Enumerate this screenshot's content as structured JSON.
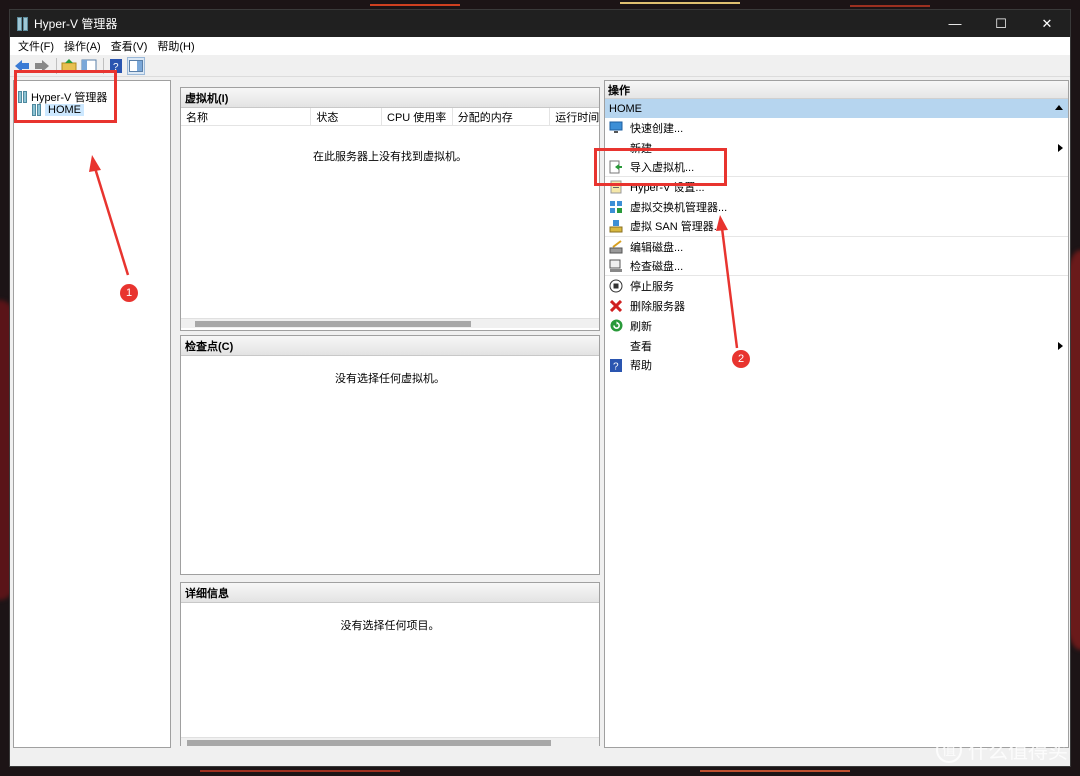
{
  "window": {
    "title": "Hyper-V 管理器"
  },
  "menus": [
    "文件(F)",
    "操作(A)",
    "查看(V)",
    "帮助(H)"
  ],
  "tree": {
    "root": "Hyper-V 管理器",
    "child": "HOME"
  },
  "vm_panel": {
    "header": "虚拟机(I)",
    "columns": [
      "名称",
      "状态",
      "CPU 使用率",
      "分配的内存",
      "运行时间"
    ],
    "empty": "在此服务器上没有找到虚拟机。"
  },
  "checkpoint_panel": {
    "header": "检查点(C)",
    "empty": "没有选择任何虚拟机。"
  },
  "details_panel": {
    "header": "详细信息",
    "empty": "没有选择任何项目。"
  },
  "actions": {
    "header": "操作",
    "group": "HOME",
    "items": [
      "快速创建...",
      "新建",
      "导入虚拟机...",
      "Hyper-V 设置...",
      "虚拟交换机管理器...",
      "虚拟 SAN 管理器...",
      "编辑磁盘...",
      "检查磁盘...",
      "停止服务",
      "删除服务器",
      "刷新",
      "查看",
      "帮助"
    ]
  },
  "annotations": {
    "badge1": "1",
    "badge2": "2"
  },
  "watermark": "什么值得买",
  "colors": {
    "annotation": "#e8342f",
    "selection": "#cce8ff",
    "home_bar": "#b6d5ef"
  }
}
